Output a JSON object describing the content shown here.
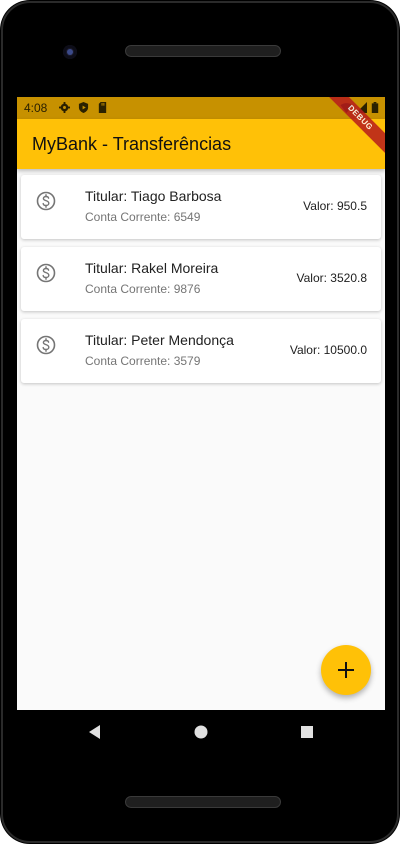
{
  "status_bar": {
    "time": "4:08",
    "left_icons": [
      "settings-icon",
      "play-protect-icon",
      "sd-card-icon"
    ],
    "right_icons": [
      "wifi-icon",
      "signal-icon",
      "battery-icon"
    ]
  },
  "app_bar": {
    "title": "MyBank - Transferências",
    "color": "#ffc107",
    "debug_banner": "DEBUG"
  },
  "transfers": [
    {
      "holder": "Titular: Tiago Barbosa",
      "account": "Conta Corrente: 6549",
      "value": "Valor: 950.5",
      "icon": "money-icon"
    },
    {
      "holder": "Titular: Rakel Moreira",
      "account": "Conta Corrente: 9876",
      "value": "Valor: 3520.8",
      "icon": "money-icon"
    },
    {
      "holder": "Titular: Peter Mendonça",
      "account": "Conta Corrente: 3579",
      "value": "Valor: 10500.0",
      "icon": "money-icon"
    }
  ],
  "fab": {
    "icon": "add-icon",
    "color": "#ffc107"
  },
  "nav_bar": {
    "buttons": [
      "back-icon",
      "home-icon",
      "recents-icon"
    ]
  }
}
